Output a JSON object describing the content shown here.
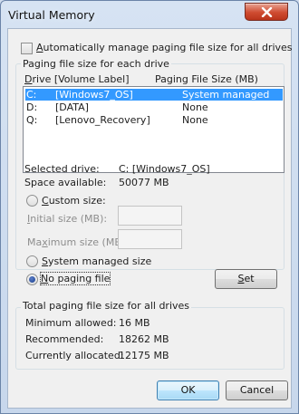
{
  "window": {
    "title": "Virtual Memory"
  },
  "auto_manage": {
    "label_prefix": "",
    "label_key": "A",
    "label_rest": "utomatically manage paging file size for all drives",
    "checked": false
  },
  "paging_group": {
    "title": "Paging file size for each drive",
    "columns": {
      "drive_key": "D",
      "drive_rest": "rive  [Volume Label]",
      "size": "Paging File Size (MB)"
    },
    "rows": [
      {
        "drive": "C:",
        "label": "[Windows7_OS]",
        "size": "System managed",
        "selected": true
      },
      {
        "drive": "D:",
        "label": "[DATA]",
        "size": "None",
        "selected": false
      },
      {
        "drive": "Q:",
        "label": "[Lenovo_Recovery]",
        "size": "None",
        "selected": false
      }
    ]
  },
  "selected_drive": {
    "label": "Selected drive:",
    "value": "C:  [Windows7_OS]"
  },
  "space_available": {
    "label": "Space available:",
    "value": "50077 MB"
  },
  "custom_size": {
    "key": "C",
    "rest": "ustom size:",
    "checked": false
  },
  "initial_size": {
    "key": "I",
    "rest": "nitial size (MB):",
    "value": ""
  },
  "maximum_size": {
    "prefix": "Ma",
    "key": "x",
    "rest": "imum size (MB):",
    "value": ""
  },
  "system_managed": {
    "prefix": "",
    "key": "S",
    "rest": "ystem managed size",
    "checked": false
  },
  "no_paging": {
    "key": "N",
    "rest": "o paging file",
    "checked": true
  },
  "set_button": {
    "key": "S",
    "rest": "et"
  },
  "total_group": {
    "title": "Total paging file size for all drives",
    "rows": [
      {
        "label": "Minimum allowed:",
        "value": "16 MB"
      },
      {
        "label": "Recommended:",
        "value": "18262 MB"
      },
      {
        "label": "Currently allocated:",
        "value": "12175 MB"
      }
    ]
  },
  "ok_button": {
    "label": "OK"
  },
  "cancel_button": {
    "label": "Cancel"
  }
}
